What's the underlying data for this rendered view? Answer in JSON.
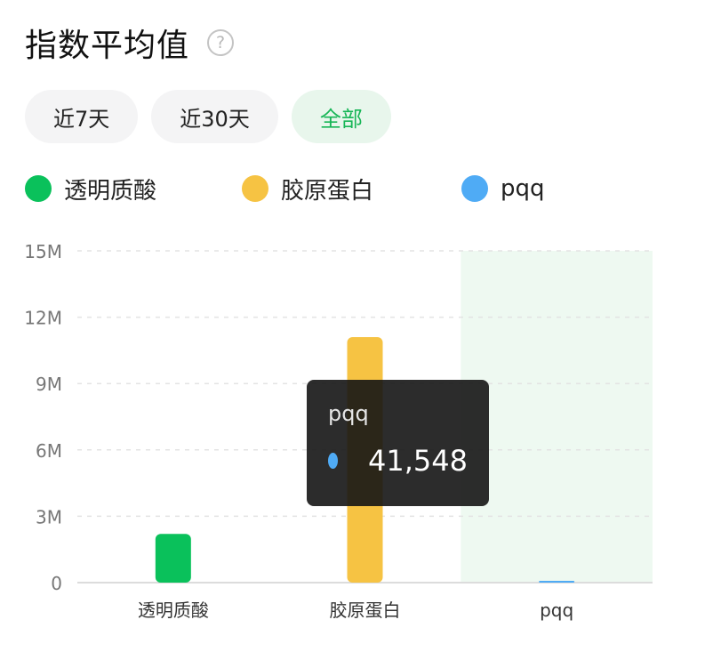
{
  "header": {
    "title": "指数平均值",
    "help_icon": "question-circle-icon",
    "help_glyph": "?"
  },
  "tabs": [
    {
      "label": "近7天",
      "active": false
    },
    {
      "label": "近30天",
      "active": false
    },
    {
      "label": "全部",
      "active": true
    }
  ],
  "legend": [
    {
      "label": "透明质酸",
      "color": "#0ac15b"
    },
    {
      "label": "胶原蛋白",
      "color": "#f6c343"
    },
    {
      "label": "pqq",
      "color": "#4fabf5"
    }
  ],
  "tooltip": {
    "title": "pqq",
    "value": "41,548",
    "color": "#4fabf5"
  },
  "colors": {
    "accent_green": "#18b657",
    "hover_band": "#eef9f1",
    "grid": "#e3e3e3",
    "axis_text": "#777777"
  },
  "chart_data": {
    "type": "bar",
    "categories": [
      "透明质酸",
      "胶原蛋白",
      "pqq"
    ],
    "values": [
      2200000,
      11100000,
      41548
    ],
    "colors": [
      "#0ac15b",
      "#f6c343",
      "#4fabf5"
    ],
    "title": "指数平均值",
    "xlabel": "",
    "ylabel": "",
    "ylim": [
      0,
      15000000
    ],
    "yticks": [
      0,
      3000000,
      6000000,
      9000000,
      12000000,
      15000000
    ],
    "ytick_labels": [
      "0",
      "3M",
      "6M",
      "9M",
      "12M",
      "15M"
    ],
    "highlighted_category": "pqq",
    "grid": true,
    "legend_position": "top-left"
  }
}
